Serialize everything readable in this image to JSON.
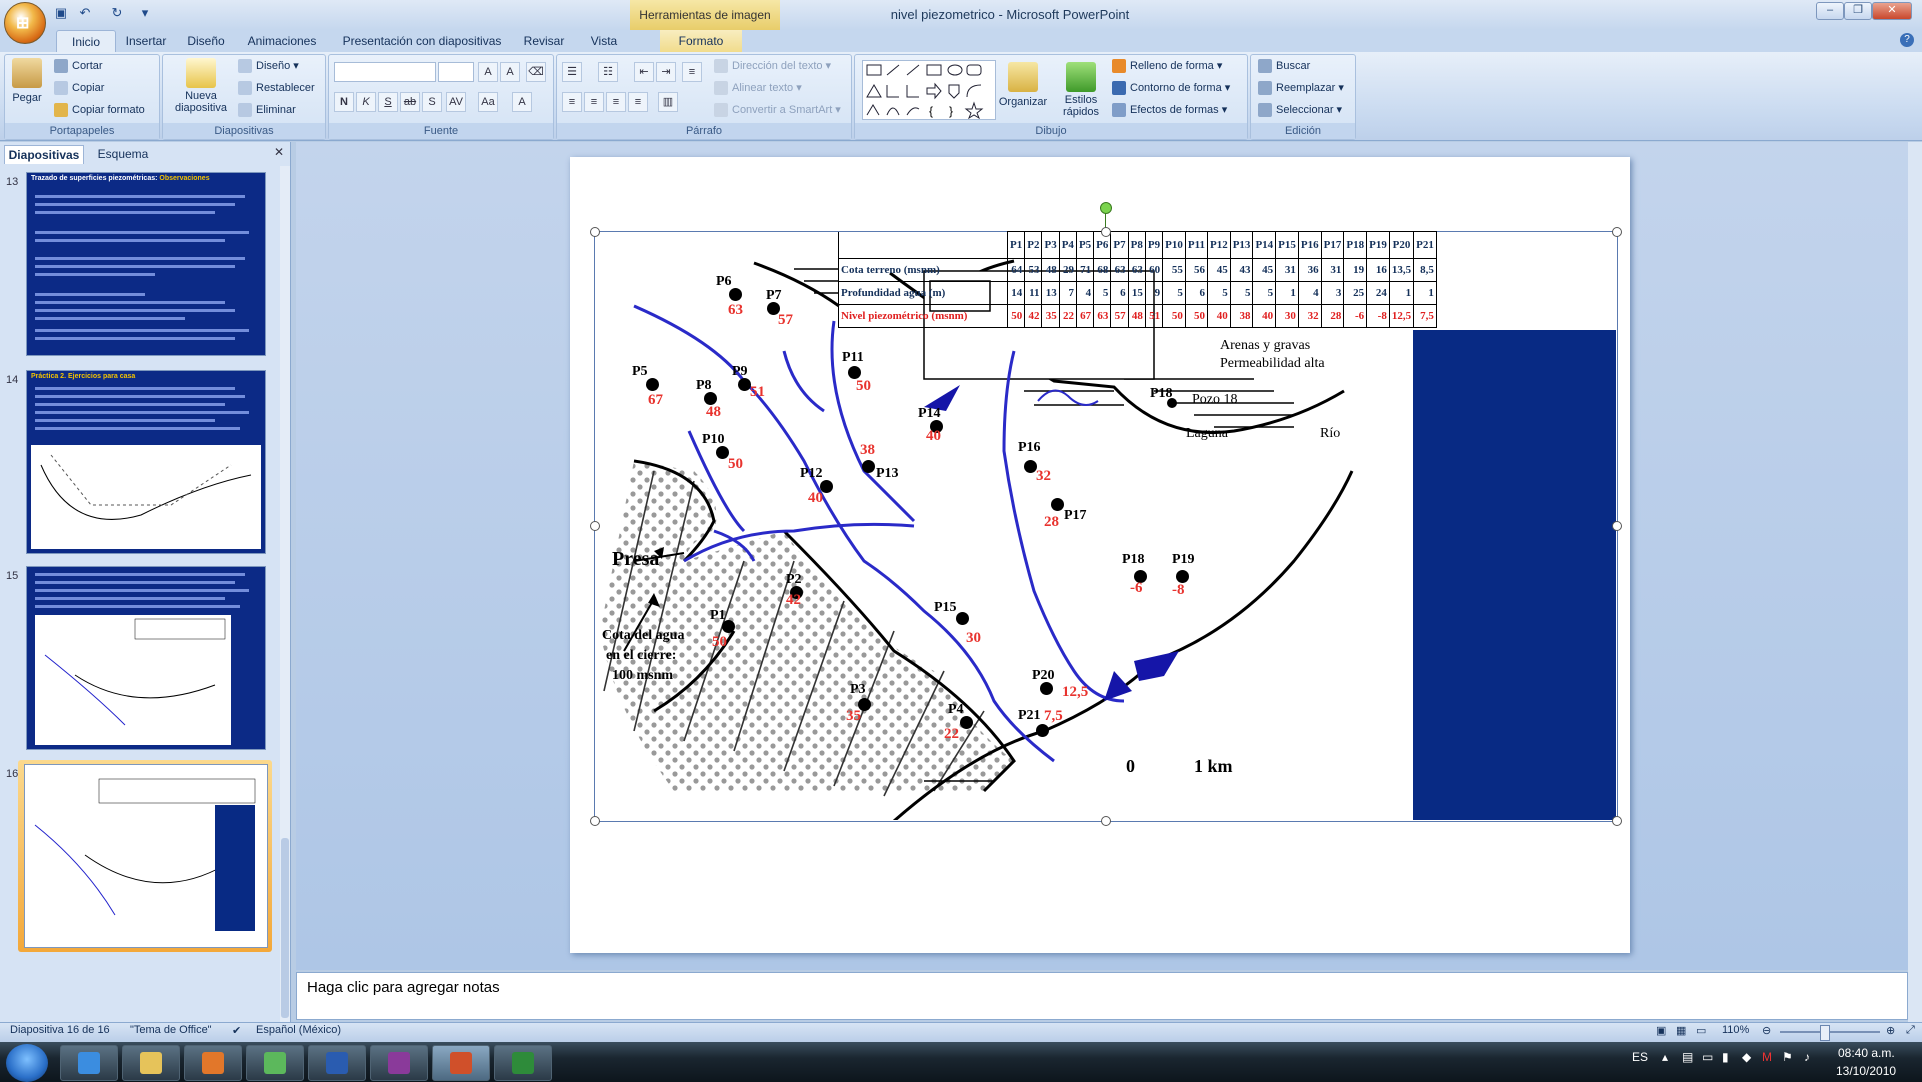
{
  "window": {
    "title": "nivel piezometrico - Microsoft PowerPoint",
    "context_tab_title": "Herramientas de imagen"
  },
  "tabs": [
    "Inicio",
    "Insertar",
    "Diseño",
    "Animaciones",
    "Presentación con diapositivas",
    "Revisar",
    "Vista",
    "Formato"
  ],
  "ribbon": {
    "portapapeles": {
      "label": "Portapapeles",
      "pegar": "Pegar",
      "cortar": "Cortar",
      "copiar": "Copiar",
      "copiar_formato": "Copiar formato"
    },
    "diapositivas": {
      "label": "Diapositivas",
      "nueva": "Nueva diapositiva",
      "diseno": "Diseño",
      "restablecer": "Restablecer",
      "eliminar": "Eliminar"
    },
    "fuente": {
      "label": "Fuente"
    },
    "parrafo": {
      "label": "Párrafo",
      "direccion": "Dirección del texto",
      "alinear": "Alinear texto",
      "smartart": "Convertir a SmartArt"
    },
    "dibujo": {
      "label": "Dibujo",
      "organizar": "Organizar",
      "estilos": "Estilos rápidos",
      "relleno": "Relleno de forma",
      "contorno": "Contorno de forma",
      "efectos": "Efectos de formas"
    },
    "edicion": {
      "label": "Edición",
      "buscar": "Buscar",
      "reemplazar": "Reemplazar",
      "seleccionar": "Seleccionar"
    }
  },
  "left_panel": {
    "tab_slides": "Diapositivas",
    "tab_outline": "Esquema",
    "slide_numbers": [
      "13",
      "14",
      "15",
      "16"
    ],
    "slide13_title": "Trazado de superficies piezométricas:",
    "slide13_title_accent": "Observaciones",
    "slide14_title": "Práctica 2. Ejercicios para casa"
  },
  "slide": {
    "table": {
      "headers": [
        "P1",
        "P2",
        "P3",
        "P4",
        "P5",
        "P6",
        "P7",
        "P8",
        "P9",
        "P10",
        "P11",
        "P12",
        "P13",
        "P14",
        "P15",
        "P16",
        "P17",
        "P18",
        "P19",
        "P20",
        "P21"
      ],
      "rows": [
        {
          "label": "Cota terreno (msnm)",
          "values": [
            "64",
            "53",
            "48",
            "29",
            "71",
            "68",
            "63",
            "63",
            "60",
            "55",
            "56",
            "45",
            "43",
            "45",
            "31",
            "36",
            "31",
            "19",
            "16",
            "13,5",
            "8,5"
          ]
        },
        {
          "label": "Profundidad agua (m)",
          "values": [
            "14",
            "11",
            "13",
            "7",
            "4",
            "5",
            "6",
            "15",
            "9",
            "5",
            "6",
            "5",
            "5",
            "5",
            "1",
            "4",
            "3",
            "25",
            "24",
            "1",
            "1"
          ]
        },
        {
          "label": "Nivel piezométrico (msnm)",
          "values": [
            "50",
            "42",
            "35",
            "22",
            "67",
            "63",
            "57",
            "48",
            "51",
            "50",
            "50",
            "40",
            "38",
            "40",
            "30",
            "32",
            "28",
            "-6",
            "-8",
            "12,5",
            "7,5"
          ]
        }
      ]
    },
    "legend": {
      "arenas": "Arenas y gravas",
      "permeabilidad": "Permeabilidad alta",
      "pozo_code": "P18",
      "pozo": "Pozo 18",
      "laguna": "Laguna",
      "rio": "Río"
    },
    "wells": [
      {
        "name": "P6",
        "val": "63"
      },
      {
        "name": "P7",
        "val": "57"
      },
      {
        "name": "P5",
        "val": "67"
      },
      {
        "name": "P8",
        "val": "48"
      },
      {
        "name": "P9",
        "val": "51"
      },
      {
        "name": "P10",
        "val": "50"
      },
      {
        "name": "P11",
        "val": "50"
      },
      {
        "name": "P14",
        "val": "40"
      },
      {
        "name": "P13",
        "val": "38"
      },
      {
        "name": "P12",
        "val": "40"
      },
      {
        "name": "P16",
        "val": "32"
      },
      {
        "name": "P17",
        "val": "28"
      },
      {
        "name": "P18",
        "val": "-6"
      },
      {
        "name": "P19",
        "val": "-8"
      },
      {
        "name": "P2",
        "val": "42"
      },
      {
        "name": "P1",
        "val": "50"
      },
      {
        "name": "P15",
        "val": "30"
      },
      {
        "name": "P20",
        "val": "12,5"
      },
      {
        "name": "P3",
        "val": "35"
      },
      {
        "name": "P4",
        "val": "22"
      },
      {
        "name": "P21",
        "val": "7,5"
      }
    ],
    "presa": "Presa",
    "cota": [
      "Cota del agua",
      "en el cierre:",
      "100 msnm"
    ],
    "scale": {
      "zero": "0",
      "km": "1 km"
    }
  },
  "notes_placeholder": "Haga clic para agregar notas",
  "status": {
    "slide": "Diapositiva 16 de 16",
    "theme": "\"Tema de Office\"",
    "language": "Español (México)",
    "zoom": "110%"
  },
  "taskbar": {
    "lang": "ES",
    "time": "08:40 a.m.",
    "date": "13/10/2010"
  },
  "colors": {
    "slide_blue": "#082a84",
    "red_values": "#e8332e",
    "river": "#2a2ac8"
  }
}
